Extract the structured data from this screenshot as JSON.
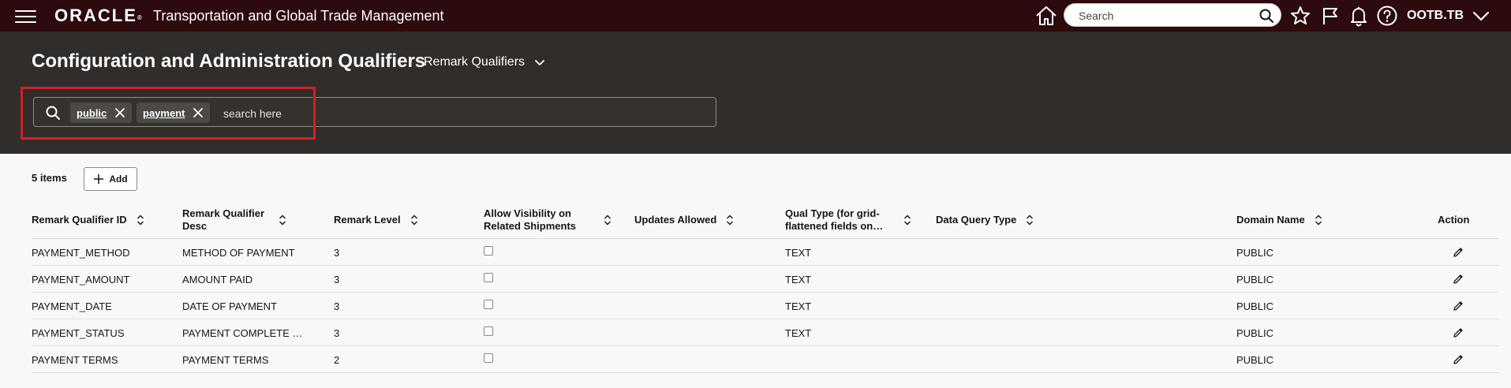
{
  "topbar": {
    "brand": "ORACLE",
    "brand_mark": "®",
    "app_title": "Transportation and Global Trade Management",
    "search_placeholder": "Search",
    "user": "OOTB.TB",
    "icons": [
      "menu-icon",
      "home-icon",
      "search-icon",
      "star-icon",
      "flag-icon",
      "bell-icon",
      "help-icon",
      "chevron-down-icon"
    ],
    "colors": {
      "bar": "#2c0a0d"
    }
  },
  "header": {
    "title": "Configuration and Administration Qualifiers",
    "subtitle": "Remark Qualifiers",
    "filter": {
      "chips": [
        "public",
        "payment"
      ],
      "placeholder": "search here"
    },
    "colors": {
      "background": "#312d2a",
      "highlight": "#d21f26"
    }
  },
  "toolbar": {
    "items_count": "5 items",
    "add_label": "Add"
  },
  "table": {
    "columns": [
      "Remark Qualifier ID",
      "Remark Qualifier Desc",
      "Remark Level",
      "Allow Visibility on Related Shipments",
      "Updates Allowed",
      "Qual Type (for grid-flattened fields on…",
      "Data Query Type",
      "Domain Name",
      "Action"
    ],
    "rows": [
      {
        "id": "PAYMENT_METHOD",
        "desc": "METHOD OF PAYMENT",
        "level": "3",
        "allow_visibility": false,
        "updates_allowed": "",
        "qual_type": "TEXT",
        "data_query_type": "",
        "domain": "PUBLIC"
      },
      {
        "id": "PAYMENT_AMOUNT",
        "desc": "AMOUNT PAID",
        "level": "3",
        "allow_visibility": false,
        "updates_allowed": "",
        "qual_type": "TEXT",
        "data_query_type": "",
        "domain": "PUBLIC"
      },
      {
        "id": "PAYMENT_DATE",
        "desc": "DATE OF PAYMENT",
        "level": "3",
        "allow_visibility": false,
        "updates_allowed": "",
        "qual_type": "TEXT",
        "data_query_type": "",
        "domain": "PUBLIC"
      },
      {
        "id": "PAYMENT_STATUS",
        "desc": "PAYMENT COMPLETE …",
        "level": "3",
        "allow_visibility": false,
        "updates_allowed": "",
        "qual_type": "TEXT",
        "data_query_type": "",
        "domain": "PUBLIC"
      },
      {
        "id": "PAYMENT TERMS",
        "desc": "PAYMENT TERMS",
        "level": "2",
        "allow_visibility": false,
        "updates_allowed": "",
        "qual_type": "",
        "data_query_type": "",
        "domain": "PUBLIC"
      }
    ]
  }
}
